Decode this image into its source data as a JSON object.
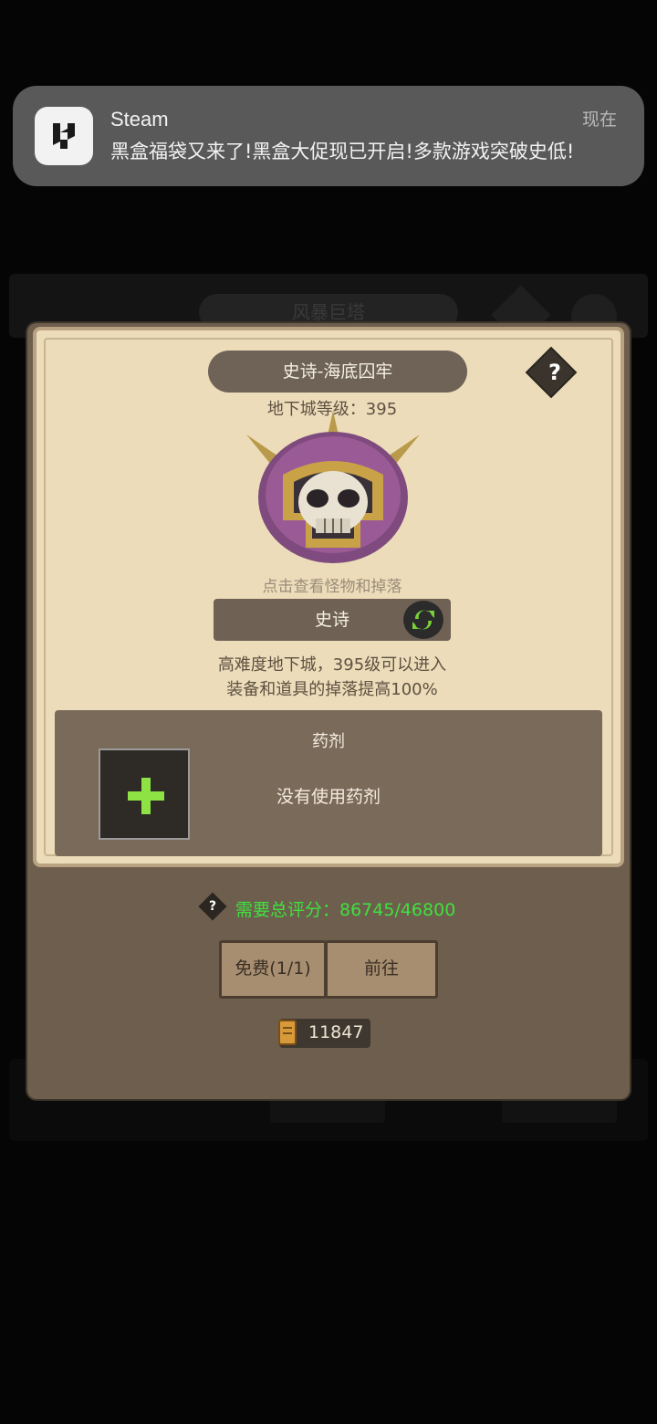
{
  "notification": {
    "app": "Steam",
    "time": "现在",
    "message": "黑盒福袋又来了!黑盒大促现已开启!多款游戏突破史低!",
    "icon": "heybox-logo-icon"
  },
  "background": {
    "tab_label": "风暴巨塔"
  },
  "dungeon": {
    "title": "史诗-海底囚牢",
    "level_label": "地下城等级：395",
    "monster_hint": "点击查看怪物和掉落",
    "difficulty": "史诗",
    "desc_line1": "高难度地下城，395级可以进入",
    "desc_line2": "装备和道具的掉落提高100%",
    "help": "?"
  },
  "potion": {
    "title": "药剂",
    "status": "没有使用药剂"
  },
  "requirement": {
    "help": "?",
    "text": "需要总评分：86745/46800"
  },
  "buttons": {
    "free": "免费(1/1)",
    "go": "前往"
  },
  "currency": {
    "value": "11847",
    "icon": "scroll-icon"
  },
  "colors": {
    "score_green": "#3fe13f",
    "plus_green": "#8fe244",
    "parchment": "#ecdcb9",
    "panel_brown": "#6e5e4d"
  }
}
